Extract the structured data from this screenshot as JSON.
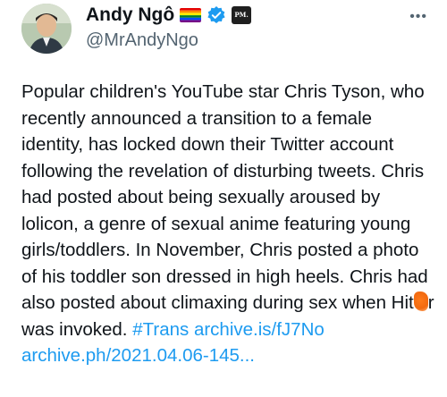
{
  "tweet": {
    "author": {
      "display_name": "Andy Ngô",
      "handle": "@MrAndyNgo",
      "badges": [
        "rainbow-flag-icon",
        "verified-icon",
        "affiliate-badge"
      ],
      "affiliate_label": "PM."
    },
    "more_icon": "more-horizontal-icon",
    "body": {
      "text_before_censor": "Popular children's YouTube star Chris Tyson, who recently announced a transition to a female identity, has locked down their Twitter account following the revelation of disturbing tweets. Chris had posted about being sexually aroused by lolicon, a genre of sexual anime featuring young girls/toddlers. In November, Chris posted a photo of his toddler son dressed in high heels. Chris had also posted about climaxing during sex when Hit",
      "text_after_censor": "r was invoked. ",
      "hashtag": "#Trans",
      "link1": "archive.is/fJ7No",
      "link2": "archive.ph/2021.04.06-145..."
    },
    "colors": {
      "text": "#0f1419",
      "secondary": "#536471",
      "link": "#1d9bf0",
      "verified": "#1d9bf0",
      "censor_mark": "#f26a10"
    }
  }
}
